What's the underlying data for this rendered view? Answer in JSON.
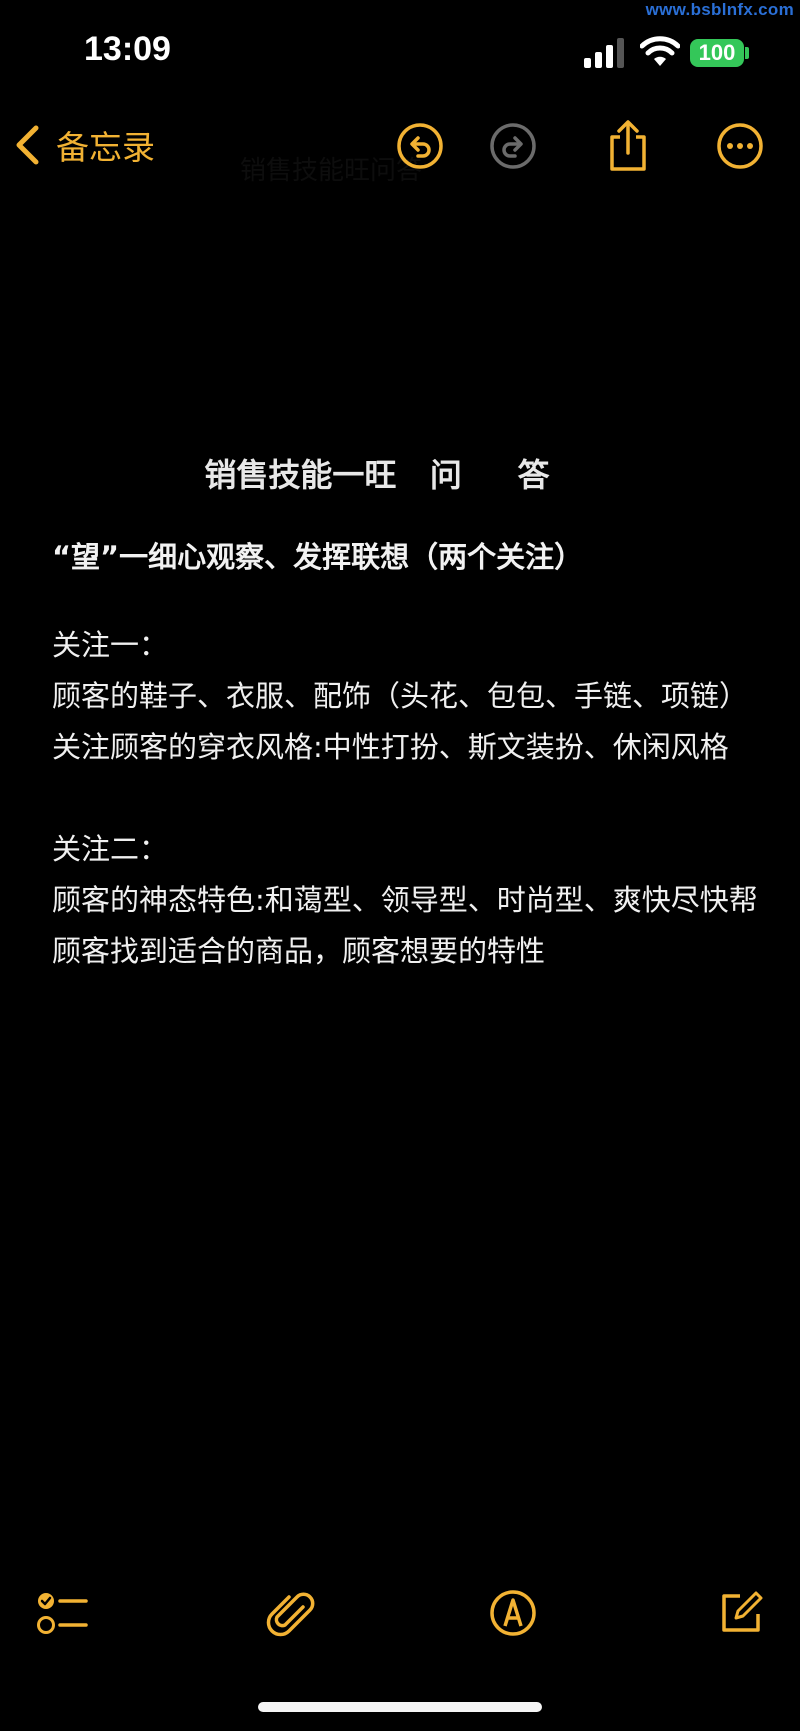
{
  "watermark": "www.bsblnfx.com",
  "status_bar": {
    "time": "13:09",
    "battery": "100"
  },
  "nav": {
    "back_label": "备忘录",
    "ghost_title": "销售技能旺问答"
  },
  "note": {
    "title": "销售技能一旺   问     答",
    "heading": "“望”一细心观察、发挥联想（两个关注）",
    "paragraphs": [
      "关注一：",
      "顾客的鞋子、衣服、配饰（头花、包包、手链、项链）关注顾客的穿衣风格:中性打扮、斯文装扮、休闲风格",
      "",
      "关注二：",
      "顾客的神态特色:和蔼型、领导型、时尚型、爽快尽快帮顾客找到适合的商品，顾客想要的特性"
    ]
  },
  "colors": {
    "accent": "#f2b233",
    "disabled": "#6b6b6b",
    "battery": "#34c759",
    "background": "#000000"
  }
}
